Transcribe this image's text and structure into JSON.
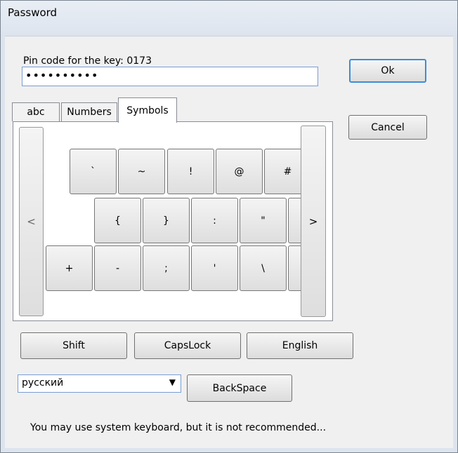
{
  "window": {
    "title": "Password"
  },
  "pin": {
    "label": "Pin code for the key: 0173",
    "masked_value": "••••••••••"
  },
  "buttons": {
    "ok": "Ok",
    "cancel": "Cancel",
    "shift": "Shift",
    "capslock": "CapsLock",
    "english": "English",
    "backspace": "BackSpace"
  },
  "tabs": [
    {
      "label": "abc"
    },
    {
      "label": "Numbers"
    },
    {
      "label": "Symbols",
      "active": true
    }
  ],
  "keyboard": {
    "scroll_left": "<",
    "scroll_right": ">",
    "rows": [
      [
        "`",
        "~",
        "!",
        "@",
        "#"
      ],
      [
        "{",
        "}",
        ":",
        "\"",
        ""
      ],
      [
        "+",
        "-",
        ";",
        "'",
        "\\",
        ""
      ]
    ]
  },
  "language_select": {
    "value": "русский",
    "arrow_icon": "triangle-down-icon"
  },
  "hint": "You may use system keyboard, but it is not recommended...",
  "colors": {
    "focus_border": "#3b8ed6",
    "input_border": "#7a9cd3",
    "window_bg": "#f0f0f0"
  }
}
